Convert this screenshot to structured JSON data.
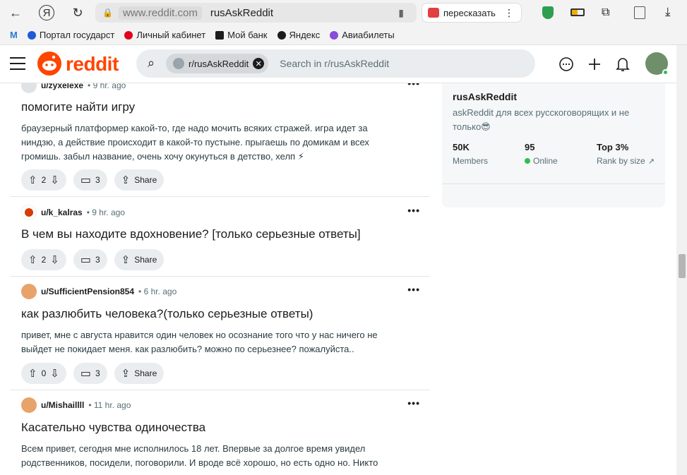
{
  "browser": {
    "url_domain": "www.reddit.com",
    "url_title": "rusAskReddit",
    "retell_label": "пересказать"
  },
  "bookmarks": [
    {
      "label": "Портал государст",
      "color": "#1e5bd8"
    },
    {
      "label": "Личный кабинет",
      "color": "#e0001a"
    },
    {
      "label": "Мой банк",
      "color": "#1c1c1c"
    },
    {
      "label": "Яндекс",
      "color": "#1c1c1c"
    },
    {
      "label": "Авиабилеты",
      "color": "#8a4cd9"
    }
  ],
  "header": {
    "logo_text": "reddit",
    "chip_label": "r/rusAskReddit",
    "search_placeholder": "Search in r/rusAskReddit"
  },
  "posts": [
    {
      "user": "u/zyxelexe",
      "time": "9 hr. ago",
      "title": "помогите найти игру",
      "body": [
        "браузерный платформер какой-то, где надо мочить всяких стражей. игра идет за",
        "ниндзю, а действие происходит в какой-то пустыне. прыгаешь по домикам и всех",
        "громишь. забыл название, очень хочу окунуться в детство, хелп ⚡"
      ],
      "votes": "2",
      "comments": "3",
      "share": "Share"
    },
    {
      "user": "u/k_kalras",
      "time": "9 hr. ago",
      "title": "В чем вы находите вдохновение? [только серьезные ответы]",
      "body": [],
      "votes": "2",
      "comments": "3",
      "share": "Share"
    },
    {
      "user": "u/SufficientPension854",
      "time": "6 hr. ago",
      "title": "как разлюбить человека?(только серьезные ответы)",
      "body": [
        "привет, мне с августа нравится один человек но осознание того что у нас ничего не",
        "выйдет не покидает меня. как разлюбить? можно по серьезнее? пожалуйста.."
      ],
      "votes": "0",
      "comments": "3",
      "share": "Share"
    },
    {
      "user": "u/Mishaillll",
      "time": "11 hr. ago",
      "title": "Касательно чувства одиночества",
      "body": [
        "Всем привет, сегодня мне исполнилось 18 лет. Впервые за долгое время увидел",
        "родственников, посидели, поговорили. И вроде всё хорошо, но есть одно но. Никто"
      ],
      "votes": "",
      "comments": "",
      "share": ""
    }
  ],
  "sidebar": {
    "title": "rusAskReddit",
    "description": "askReddit для всех русскоговорящих и не только😎",
    "stats": [
      {
        "value": "50K",
        "label": "Members"
      },
      {
        "value": "95",
        "label": "Online"
      },
      {
        "value": "Top 3%",
        "label": "Rank by size"
      }
    ]
  },
  "colors": {
    "brand": "#ff4500",
    "online": "#2ebf4f"
  }
}
